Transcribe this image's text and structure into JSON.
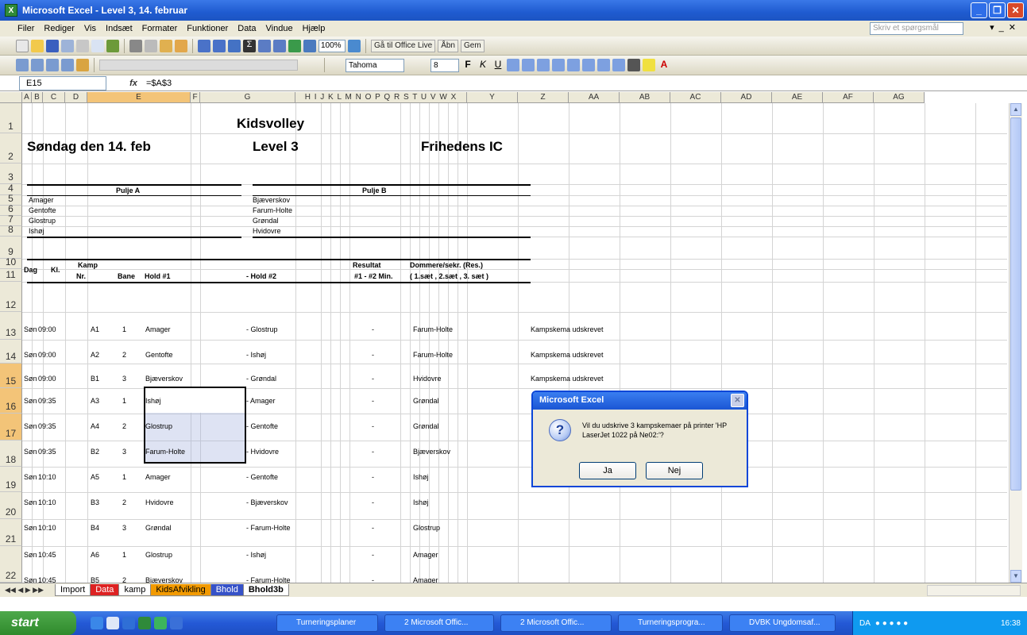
{
  "window": {
    "title": "Microsoft Excel - Level 3, 14. februar"
  },
  "menu": {
    "items": [
      "Filer",
      "Rediger",
      "Vis",
      "Indsæt",
      "Formater",
      "Funktioner",
      "Data",
      "Vindue",
      "Hjælp"
    ],
    "help_placeholder": "Skriv et spørgsmål"
  },
  "toolbar": {
    "zoom": "100%",
    "office_live": "Gå til Office Live",
    "open": "Åbn",
    "save": "Gem",
    "font": "Tahoma",
    "font_size": "8"
  },
  "formula_bar": {
    "cell": "E15",
    "fx": "fx",
    "formula": "=$A$3"
  },
  "columns": [
    "A",
    "B",
    "C",
    "D",
    "E",
    "F",
    "G",
    "H",
    "I",
    "J",
    "K",
    "L",
    "M",
    "N",
    "O",
    "P",
    "Q",
    "R",
    "S",
    "T",
    "U",
    "V",
    "W",
    "X",
    "Y",
    "Z",
    "AA",
    "AB",
    "AC",
    "AD",
    "AE",
    "AF",
    "AG"
  ],
  "column_header_compact": "H I J K L M N O P Q R S T U V W X",
  "rows": [
    "1",
    "2",
    "3",
    "4",
    "5",
    "6",
    "7",
    "8",
    "9",
    "10",
    "11",
    "12",
    "13",
    "14",
    "15",
    "16",
    "17",
    "18",
    "19",
    "20",
    "21",
    "22"
  ],
  "sheet": {
    "title": "Kidsvolley",
    "date": "Søndag den 14. feb",
    "level": "Level 3",
    "venue": "Frihedens IC",
    "pool_a": {
      "label": "Pulje A",
      "teams": [
        "Amager",
        "Gentofte",
        "Glostrup",
        "Ishøj"
      ]
    },
    "pool_b": {
      "label": "Pulje B",
      "teams": [
        "Bjæverskov",
        "Farum-Holte",
        "Grøndal",
        "Hvidovre"
      ]
    },
    "headers": {
      "dag": "Dag",
      "kl": "Kl.",
      "kamp": "Kamp",
      "nr": "Nr.",
      "bane": "Bane",
      "hold1": "Hold #1",
      "hold2": "- Hold #2",
      "resultat": "Resultat",
      "score": "#1 - #2 Min.",
      "dommere": "Dommere/sekr. (Res.)",
      "saet": "( 1.sæt  , 2.sæt  , 3. sæt  )"
    },
    "matches": [
      {
        "dag": "Søn",
        "kl": "09:00",
        "nr": "A1",
        "bane": "1",
        "hold1": "Amager",
        "hold2": "- Glostrup",
        "dash": "-",
        "dommer": "Farum-Holte",
        "note": "Kampskema udskrevet"
      },
      {
        "dag": "Søn",
        "kl": "09:00",
        "nr": "A2",
        "bane": "2",
        "hold1": "Gentofte",
        "hold2": "- Ishøj",
        "dash": "-",
        "dommer": "Farum-Holte",
        "note": "Kampskema udskrevet"
      },
      {
        "dag": "Søn",
        "kl": "09:00",
        "nr": "B1",
        "bane": "3",
        "hold1": "Bjæverskov",
        "hold2": "- Grøndal",
        "dash": "-",
        "dommer": "Hvidovre",
        "note": "Kampskema udskrevet"
      },
      {
        "dag": "Søn",
        "kl": "09:35",
        "nr": "A3",
        "bane": "1",
        "hold1": "Ishøj",
        "hold2": "- Amager",
        "dash": "-",
        "dommer": "Grøndal",
        "note": ""
      },
      {
        "dag": "Søn",
        "kl": "09:35",
        "nr": "A4",
        "bane": "2",
        "hold1": "Glostrup",
        "hold2": "- Gentofte",
        "dash": "-",
        "dommer": "Grøndal",
        "note": ""
      },
      {
        "dag": "Søn",
        "kl": "09:35",
        "nr": "B2",
        "bane": "3",
        "hold1": "Farum-Holte",
        "hold2": "- Hvidovre",
        "dash": "-",
        "dommer": "Bjæverskov",
        "note": ""
      },
      {
        "dag": "Søn",
        "kl": "10:10",
        "nr": "A5",
        "bane": "1",
        "hold1": "Amager",
        "hold2": "- Gentofte",
        "dash": "-",
        "dommer": "Ishøj",
        "note": ""
      },
      {
        "dag": "Søn",
        "kl": "10:10",
        "nr": "B3",
        "bane": "2",
        "hold1": "Hvidovre",
        "hold2": "- Bjæverskov",
        "dash": "-",
        "dommer": "Ishøj",
        "note": ""
      },
      {
        "dag": "Søn",
        "kl": "10:10",
        "nr": "B4",
        "bane": "3",
        "hold1": "Grøndal",
        "hold2": "- Farum-Holte",
        "dash": "-",
        "dommer": "Glostrup",
        "note": ""
      },
      {
        "dag": "Søn",
        "kl": "10:45",
        "nr": "A6",
        "bane": "1",
        "hold1": "Glostrup",
        "hold2": "- Ishøj",
        "dash": "-",
        "dommer": "Amager",
        "note": ""
      },
      {
        "dag": "Søn",
        "kl": "10:45",
        "nr": "B5",
        "bane": "2",
        "hold1": "Bjæverskov",
        "hold2": "- Farum-Holte",
        "dash": "-",
        "dommer": "Amager",
        "note": ""
      }
    ]
  },
  "tabs": [
    "Import",
    "Data",
    "kamp",
    "KidsAfvikling",
    "Bhold",
    "Bhold3b"
  ],
  "dialog": {
    "title": "Microsoft Excel",
    "message": "Vil du udskrive 3 kampskemaer på printer 'HP LaserJet 1022 på Ne02:'?",
    "yes": "Ja",
    "no": "Nej"
  },
  "taskbar": {
    "start": "start",
    "items": [
      "Turneringsplaner",
      "2 Microsoft Offic...",
      "2 Microsoft Offic...",
      "Turneringsprogra...",
      "DVBK Ungdomsaf..."
    ],
    "lang": "DA",
    "time": "16:38"
  }
}
